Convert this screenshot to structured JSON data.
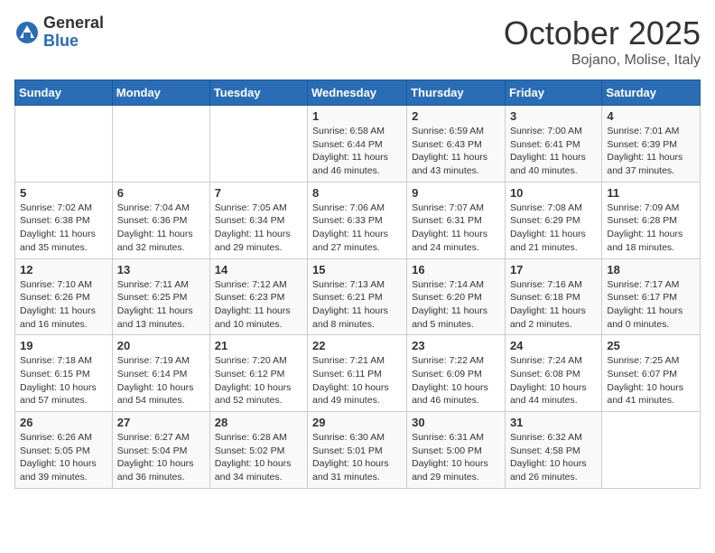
{
  "logo": {
    "general": "General",
    "blue": "Blue"
  },
  "title": "October 2025",
  "subtitle": "Bojano, Molise, Italy",
  "weekdays": [
    "Sunday",
    "Monday",
    "Tuesday",
    "Wednesday",
    "Thursday",
    "Friday",
    "Saturday"
  ],
  "weeks": [
    [
      {
        "day": "",
        "info": ""
      },
      {
        "day": "",
        "info": ""
      },
      {
        "day": "",
        "info": ""
      },
      {
        "day": "1",
        "info": "Sunrise: 6:58 AM\nSunset: 6:44 PM\nDaylight: 11 hours\nand 46 minutes."
      },
      {
        "day": "2",
        "info": "Sunrise: 6:59 AM\nSunset: 6:43 PM\nDaylight: 11 hours\nand 43 minutes."
      },
      {
        "day": "3",
        "info": "Sunrise: 7:00 AM\nSunset: 6:41 PM\nDaylight: 11 hours\nand 40 minutes."
      },
      {
        "day": "4",
        "info": "Sunrise: 7:01 AM\nSunset: 6:39 PM\nDaylight: 11 hours\nand 37 minutes."
      }
    ],
    [
      {
        "day": "5",
        "info": "Sunrise: 7:02 AM\nSunset: 6:38 PM\nDaylight: 11 hours\nand 35 minutes."
      },
      {
        "day": "6",
        "info": "Sunrise: 7:04 AM\nSunset: 6:36 PM\nDaylight: 11 hours\nand 32 minutes."
      },
      {
        "day": "7",
        "info": "Sunrise: 7:05 AM\nSunset: 6:34 PM\nDaylight: 11 hours\nand 29 minutes."
      },
      {
        "day": "8",
        "info": "Sunrise: 7:06 AM\nSunset: 6:33 PM\nDaylight: 11 hours\nand 27 minutes."
      },
      {
        "day": "9",
        "info": "Sunrise: 7:07 AM\nSunset: 6:31 PM\nDaylight: 11 hours\nand 24 minutes."
      },
      {
        "day": "10",
        "info": "Sunrise: 7:08 AM\nSunset: 6:29 PM\nDaylight: 11 hours\nand 21 minutes."
      },
      {
        "day": "11",
        "info": "Sunrise: 7:09 AM\nSunset: 6:28 PM\nDaylight: 11 hours\nand 18 minutes."
      }
    ],
    [
      {
        "day": "12",
        "info": "Sunrise: 7:10 AM\nSunset: 6:26 PM\nDaylight: 11 hours\nand 16 minutes."
      },
      {
        "day": "13",
        "info": "Sunrise: 7:11 AM\nSunset: 6:25 PM\nDaylight: 11 hours\nand 13 minutes."
      },
      {
        "day": "14",
        "info": "Sunrise: 7:12 AM\nSunset: 6:23 PM\nDaylight: 11 hours\nand 10 minutes."
      },
      {
        "day": "15",
        "info": "Sunrise: 7:13 AM\nSunset: 6:21 PM\nDaylight: 11 hours\nand 8 minutes."
      },
      {
        "day": "16",
        "info": "Sunrise: 7:14 AM\nSunset: 6:20 PM\nDaylight: 11 hours\nand 5 minutes."
      },
      {
        "day": "17",
        "info": "Sunrise: 7:16 AM\nSunset: 6:18 PM\nDaylight: 11 hours\nand 2 minutes."
      },
      {
        "day": "18",
        "info": "Sunrise: 7:17 AM\nSunset: 6:17 PM\nDaylight: 11 hours\nand 0 minutes."
      }
    ],
    [
      {
        "day": "19",
        "info": "Sunrise: 7:18 AM\nSunset: 6:15 PM\nDaylight: 10 hours\nand 57 minutes."
      },
      {
        "day": "20",
        "info": "Sunrise: 7:19 AM\nSunset: 6:14 PM\nDaylight: 10 hours\nand 54 minutes."
      },
      {
        "day": "21",
        "info": "Sunrise: 7:20 AM\nSunset: 6:12 PM\nDaylight: 10 hours\nand 52 minutes."
      },
      {
        "day": "22",
        "info": "Sunrise: 7:21 AM\nSunset: 6:11 PM\nDaylight: 10 hours\nand 49 minutes."
      },
      {
        "day": "23",
        "info": "Sunrise: 7:22 AM\nSunset: 6:09 PM\nDaylight: 10 hours\nand 46 minutes."
      },
      {
        "day": "24",
        "info": "Sunrise: 7:24 AM\nSunset: 6:08 PM\nDaylight: 10 hours\nand 44 minutes."
      },
      {
        "day": "25",
        "info": "Sunrise: 7:25 AM\nSunset: 6:07 PM\nDaylight: 10 hours\nand 41 minutes."
      }
    ],
    [
      {
        "day": "26",
        "info": "Sunrise: 6:26 AM\nSunset: 5:05 PM\nDaylight: 10 hours\nand 39 minutes."
      },
      {
        "day": "27",
        "info": "Sunrise: 6:27 AM\nSunset: 5:04 PM\nDaylight: 10 hours\nand 36 minutes."
      },
      {
        "day": "28",
        "info": "Sunrise: 6:28 AM\nSunset: 5:02 PM\nDaylight: 10 hours\nand 34 minutes."
      },
      {
        "day": "29",
        "info": "Sunrise: 6:30 AM\nSunset: 5:01 PM\nDaylight: 10 hours\nand 31 minutes."
      },
      {
        "day": "30",
        "info": "Sunrise: 6:31 AM\nSunset: 5:00 PM\nDaylight: 10 hours\nand 29 minutes."
      },
      {
        "day": "31",
        "info": "Sunrise: 6:32 AM\nSunset: 4:58 PM\nDaylight: 10 hours\nand 26 minutes."
      },
      {
        "day": "",
        "info": ""
      }
    ]
  ]
}
